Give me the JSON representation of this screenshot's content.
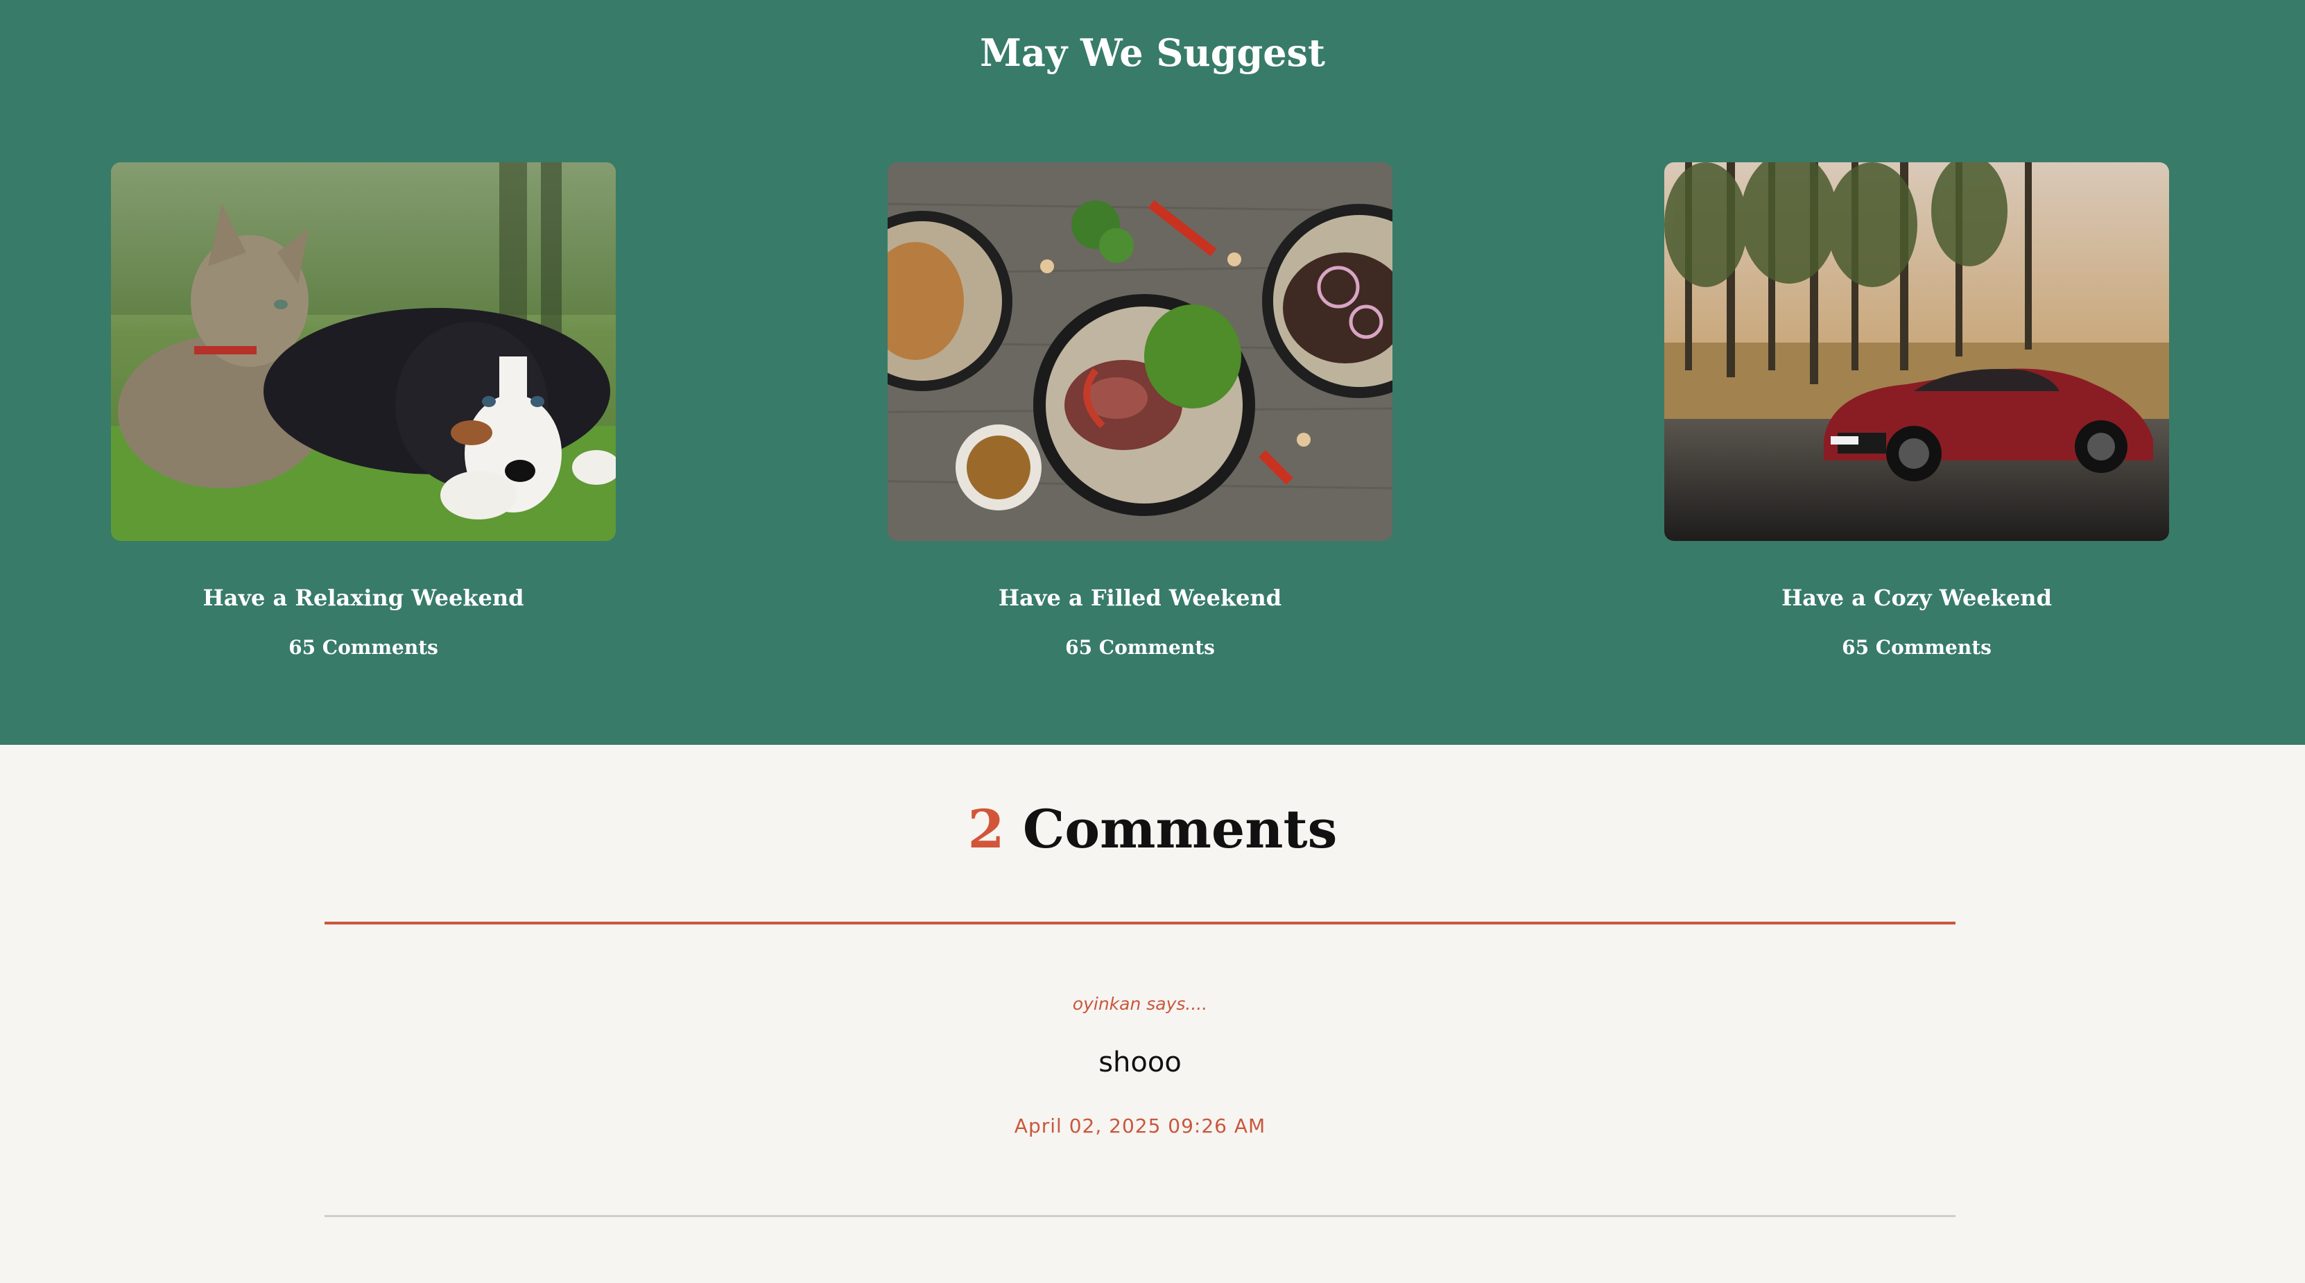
{
  "suggest": {
    "title": "May We Suggest",
    "cards": [
      {
        "title": "Have a Relaxing Weekend",
        "comments": "65 Comments",
        "image": "cat-and-puppy-photo"
      },
      {
        "title": "Have a Filled Weekend",
        "comments": "65 Comments",
        "image": "food-plates-photo"
      },
      {
        "title": "Have a Cozy Weekend",
        "comments": "65 Comments",
        "image": "red-sports-car-photo"
      }
    ]
  },
  "comments_section": {
    "count": "2",
    "label": "Comments",
    "items": [
      {
        "author": "oyinkan says....",
        "body": "shooo",
        "date": "April 02, 2025 09:26 AM"
      }
    ]
  },
  "colors": {
    "green": "#387b68",
    "accent": "#c9573e",
    "background": "#f7f5f1"
  }
}
